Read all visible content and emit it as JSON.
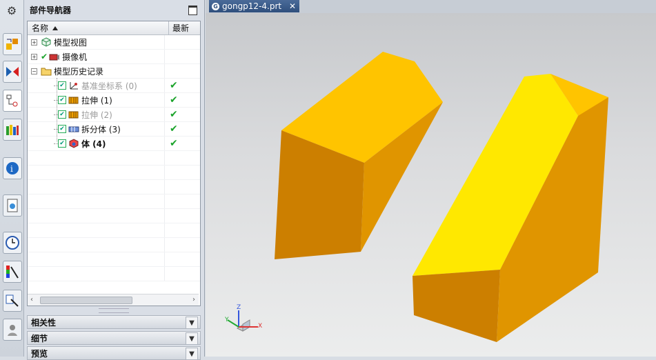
{
  "resource_bar": {
    "buttons": [
      "settings-icon",
      "assembly-navigator-icon",
      "constraint-navigator-icon",
      "part-navigator-icon",
      "reuse-library-icon",
      "hd3d-icon",
      "web-browser-icon",
      "history-icon",
      "system-materials-icon",
      "roles-icon",
      "process-studio-icon"
    ]
  },
  "navigator": {
    "title": "部件导航器",
    "columns": {
      "name": "名称",
      "latest": "最新"
    },
    "items": [
      {
        "label": "模型视图",
        "icon": "model-views-icon",
        "style": "normal",
        "latest": ""
      },
      {
        "label": "摄像机",
        "icon": "camera-icon",
        "style": "normal",
        "latest": ""
      },
      {
        "label": "模型历史记录",
        "icon": "folder-icon",
        "style": "normal",
        "latest": ""
      },
      {
        "label": "基准坐标系 (0)",
        "icon": "datum-csys-icon",
        "style": "gray",
        "latest": "✔"
      },
      {
        "label": "拉伸 (1)",
        "icon": "extrude-icon",
        "style": "normal",
        "latest": "✔"
      },
      {
        "label": "拉伸 (2)",
        "icon": "extrude-icon",
        "style": "gray",
        "latest": "✔"
      },
      {
        "label": "拆分体 (3)",
        "icon": "split-body-icon",
        "style": "normal",
        "latest": "✔"
      },
      {
        "label": "体 (4)",
        "icon": "body-icon",
        "style": "bold",
        "latest": "✔"
      }
    ],
    "sections": [
      "相关性",
      "细节",
      "预览"
    ]
  },
  "graphics": {
    "tab_label": "gongp12-4.prt",
    "tab_close": "✕",
    "triad": {
      "x": "X",
      "y": "Y",
      "z": "Z"
    },
    "colors": {
      "dark": "#cc7f00",
      "mid": "#e09500",
      "top": "#ffc400",
      "bright": "#ffe800"
    }
  }
}
